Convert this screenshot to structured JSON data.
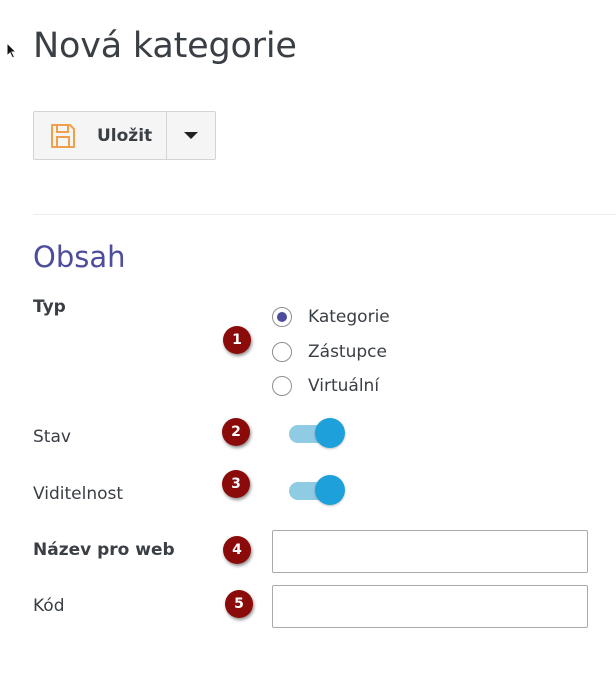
{
  "page": {
    "title": "Nová kategorie"
  },
  "toolbar": {
    "save_label": "Uložit"
  },
  "section": {
    "title": "Obsah"
  },
  "form": {
    "type": {
      "label": "Typ",
      "options": [
        "Kategorie",
        "Zástupce",
        "Virtuální"
      ],
      "selected": "Kategorie"
    },
    "status": {
      "label": "Stav",
      "enabled": true
    },
    "visibility": {
      "label": "Viditelnost",
      "enabled": true
    },
    "web_name": {
      "label": "Název pro web",
      "value": ""
    },
    "code": {
      "label": "Kód",
      "value": ""
    }
  },
  "badges": [
    "1",
    "2",
    "3",
    "4",
    "5"
  ],
  "colors": {
    "accent": "#4d4d9c",
    "toggle_on": "#1ea1da",
    "badge": "#8b0a0a",
    "save_icon": "#f0a04b"
  }
}
